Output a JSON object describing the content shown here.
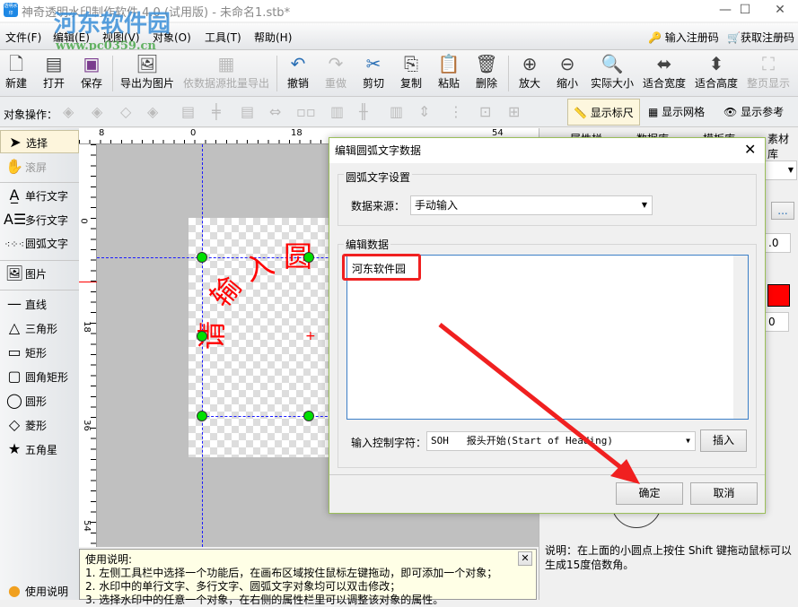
{
  "window": {
    "title": "神奇透明水印制作软件 4.0 (试用版) - 未命名1.stb*",
    "app_icon_text": "透明水印"
  },
  "watermark": {
    "name": "河东软件园",
    "url": "www.pc0359.cn"
  },
  "menu": [
    "文件(F)",
    "编辑(E)",
    "视图(V)",
    "对象(O)",
    "工具(T)",
    "帮助(H)"
  ],
  "register": {
    "enter": "输入注册码",
    "buy": "获取注册码"
  },
  "toolbar": [
    {
      "label": "新建",
      "icon": "new-file-icon",
      "enabled": true
    },
    {
      "label": "打开",
      "icon": "open-icon",
      "enabled": true
    },
    {
      "label": "保存",
      "icon": "save-icon",
      "enabled": true
    },
    {
      "label": "导出为图片",
      "icon": "export-image-icon",
      "enabled": true
    },
    {
      "label": "依数据源批量导出",
      "icon": "batch-export-icon",
      "enabled": false
    },
    {
      "label": "撤销",
      "icon": "undo-icon",
      "enabled": true
    },
    {
      "label": "重做",
      "icon": "redo-icon",
      "enabled": false
    },
    {
      "label": "剪切",
      "icon": "cut-icon",
      "enabled": true
    },
    {
      "label": "复制",
      "icon": "copy-icon",
      "enabled": true
    },
    {
      "label": "粘贴",
      "icon": "paste-icon",
      "enabled": true
    },
    {
      "label": "删除",
      "icon": "delete-icon",
      "enabled": true
    },
    {
      "label": "放大",
      "icon": "zoom-in-icon",
      "enabled": true
    },
    {
      "label": "缩小",
      "icon": "zoom-out-icon",
      "enabled": true
    },
    {
      "label": "实际大小",
      "icon": "actual-size-icon",
      "enabled": true
    },
    {
      "label": "适合宽度",
      "icon": "fit-width-icon",
      "enabled": true
    },
    {
      "label": "适合高度",
      "icon": "fit-height-icon",
      "enabled": true
    },
    {
      "label": "整页显示",
      "icon": "full-page-icon",
      "enabled": false
    }
  ],
  "ops": {
    "label": "对象操作：",
    "show_ruler": "显示标尺",
    "show_grid": "显示网格",
    "show_guides": "显示参考线"
  },
  "tools": [
    {
      "label": "选择",
      "icon": "arrow-icon",
      "selected": true
    },
    {
      "label": "滚屏",
      "icon": "hand-icon"
    },
    {
      "label": "单行文字",
      "icon": "single-text-icon"
    },
    {
      "label": "多行文字",
      "icon": "multi-text-icon"
    },
    {
      "label": "圆弧文字",
      "icon": "arc-text-icon"
    },
    {
      "label": "图片",
      "icon": "image-icon"
    },
    {
      "label": "直线",
      "icon": "line-icon"
    },
    {
      "label": "三角形",
      "icon": "triangle-icon"
    },
    {
      "label": "矩形",
      "icon": "rectangle-icon"
    },
    {
      "label": "圆角矩形",
      "icon": "rounded-rect-icon"
    },
    {
      "label": "圆形",
      "icon": "circle-icon"
    },
    {
      "label": "菱形",
      "icon": "diamond-icon"
    },
    {
      "label": "五角星",
      "icon": "star-icon"
    }
  ],
  "help_button": "使用说明",
  "ruler": {
    "top": [
      "8",
      "0",
      "18",
      "54"
    ],
    "left": [
      "0",
      "18",
      "36",
      "54"
    ]
  },
  "canvas": {
    "arc_text": "请输入圆",
    "text_color": "#ff0000"
  },
  "help": {
    "title": "使用说明:",
    "lines": [
      "1. 左侧工具栏中选择一个功能后，在画布区域按住鼠标左键拖动，即可添加一个对象；",
      "2. 水印中的单行文字、多行文字、圆弧文字对象均可以双击修改；",
      "3. 选择水印中的任意一个对象，在右侧的属性栏里可以调整该对象的属性。"
    ]
  },
  "right_panel": {
    "tabs": [
      "属性栏",
      "数据库",
      "模板库",
      "素材库"
    ],
    "value1": ".0",
    "value2": "0",
    "color": "#ff0000",
    "ellipsis": "...",
    "note": "说明：在上面的小圆点上按住 Shift 键拖动鼠标可以生成15度倍数角。"
  },
  "dialog": {
    "title": "编辑圆弧文字数据",
    "group1": "圆弧文字设置",
    "source_label": "数据来源：",
    "source_value": "手动输入",
    "group2": "编辑数据",
    "text": "河东软件园",
    "ctrl_label": "输入控制字符：",
    "ctrl_value": "SOH   报头开始(Start of Heading)",
    "insert": "插入",
    "ok": "确定",
    "cancel": "取消"
  }
}
